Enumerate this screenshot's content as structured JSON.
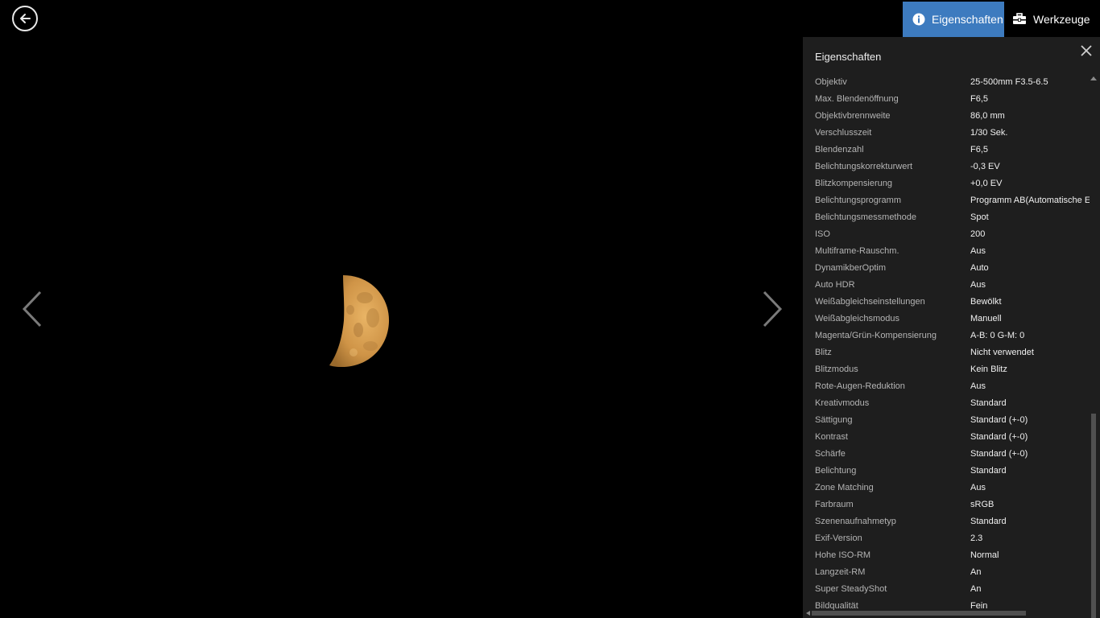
{
  "toolbar": {
    "properties_label": "Eigenschaften",
    "tools_label": "Werkzeuge"
  },
  "panel": {
    "title": "Eigenschaften",
    "properties": [
      {
        "key": "Objektiv",
        "value": "25-500mm F3.5-6.5"
      },
      {
        "key": "Max. Blendenöffnung",
        "value": "F6,5"
      },
      {
        "key": "Objektivbrennweite",
        "value": "86,0 mm"
      },
      {
        "key": "Verschlusszeit",
        "value": "1/30 Sek."
      },
      {
        "key": "Blendenzahl",
        "value": "F6,5"
      },
      {
        "key": "Belichtungskorrekturwert",
        "value": "-0,3 EV"
      },
      {
        "key": "Blitzkompensierung",
        "value": "+0,0 EV"
      },
      {
        "key": "Belichtungsprogramm",
        "value": "Programm AB(Automatische E"
      },
      {
        "key": "Belichtungsmessmethode",
        "value": "Spot"
      },
      {
        "key": "ISO",
        "value": "200"
      },
      {
        "key": "Multiframe-Rauschm.",
        "value": "Aus"
      },
      {
        "key": "DynamikberOptim",
        "value": "Auto"
      },
      {
        "key": "Auto HDR",
        "value": "Aus"
      },
      {
        "key": "Weißabgleichseinstellungen",
        "value": "Bewölkt"
      },
      {
        "key": "Weißabgleichsmodus",
        "value": "Manuell"
      },
      {
        "key": "Magenta/Grün-Kompensierung",
        "value": "A-B: 0 G-M: 0"
      },
      {
        "key": "Blitz",
        "value": "Nicht verwendet"
      },
      {
        "key": "Blitzmodus",
        "value": "Kein Blitz"
      },
      {
        "key": "Rote-Augen-Reduktion",
        "value": "Aus"
      },
      {
        "key": "Kreativmodus",
        "value": "Standard"
      },
      {
        "key": "Sättigung",
        "value": "Standard (+-0)"
      },
      {
        "key": "Kontrast",
        "value": "Standard (+-0)"
      },
      {
        "key": "Schärfe",
        "value": "Standard (+-0)"
      },
      {
        "key": "Belichtung",
        "value": "Standard"
      },
      {
        "key": "Zone Matching",
        "value": "Aus"
      },
      {
        "key": "Farbraum",
        "value": "sRGB"
      },
      {
        "key": "Szenenaufnahmetyp",
        "value": "Standard"
      },
      {
        "key": "Exif-Version",
        "value": "2.3"
      },
      {
        "key": "Hohe ISO-RM",
        "value": "Normal"
      },
      {
        "key": "Langzeit-RM",
        "value": "An"
      },
      {
        "key": "Super SteadyShot",
        "value": "An"
      },
      {
        "key": "Bildqualität",
        "value": "Fein"
      }
    ]
  },
  "icons": {
    "back": "back-arrow-circle-icon",
    "prev": "chevron-left-icon",
    "next": "chevron-right-icon",
    "info": "info-icon",
    "tools": "toolbox-icon",
    "close": "close-icon"
  },
  "colors": {
    "accent": "#3d7bbf",
    "panel_bg": "#1e1e1e",
    "moon": "#e0a95a"
  }
}
